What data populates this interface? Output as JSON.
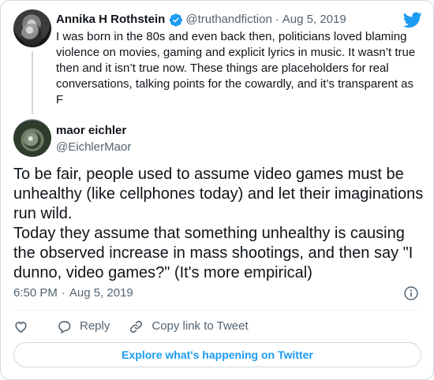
{
  "parent_tweet": {
    "author_name": "Annika H Rothstein",
    "handle": "@truthandfiction",
    "separator": "·",
    "date": "Aug 5, 2019",
    "text": "I was born in the 80s and even back then, politicians loved blaming violence on movies, gaming and explicit lyrics in music. It wasn’t true then and it isn’t true now. These things are placeholders for real conversations, talking points for the cowardly, and it’s transparent as F"
  },
  "tweet": {
    "author_name": "maor eichler",
    "handle": "@EichlerMaor",
    "paragraphs": [
      "To be fair, people used to assume video games must be unhealthy (like cellphones today) and let their imaginations run wild.",
      "Today they assume that something unhealthy is causing the observed increase in mass shootings, and then say \"I dunno, video games?\" (It's more empirical)"
    ],
    "time": "6:50 PM",
    "separator": "·",
    "date": "Aug 5, 2019"
  },
  "actions": {
    "reply_label": "Reply",
    "copy_link_label": "Copy link to Tweet"
  },
  "explore_button_label": "Explore what's happening on Twitter",
  "icons": {
    "brand": "twitter-bird-icon",
    "verified": "verified-badge-icon",
    "info": "info-icon",
    "like": "heart-icon",
    "reply": "reply-bubble-icon",
    "copy": "link-icon"
  },
  "colors": {
    "brand_blue": "#1d9bf0",
    "text_primary": "#0f1419",
    "text_secondary": "#536471",
    "border": "#cfd9de"
  }
}
